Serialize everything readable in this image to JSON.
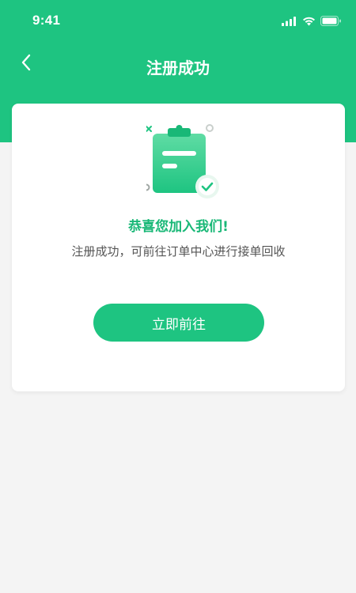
{
  "status_bar": {
    "time": "9:41",
    "icons": [
      "signal-icon",
      "wifi-icon",
      "battery-icon"
    ]
  },
  "nav": {
    "back_icon": "chevron-left-icon",
    "title": "注册成功"
  },
  "card": {
    "illustration_icon": "clipboard-check-icon",
    "headline": "恭喜您加入我们!",
    "description": "注册成功，可前往订单中心进行接单回收",
    "button_label": "立即前往"
  },
  "colors": {
    "brand_green": "#1ec481",
    "headline_green": "#19b877",
    "page_bg": "#f4f4f4"
  }
}
